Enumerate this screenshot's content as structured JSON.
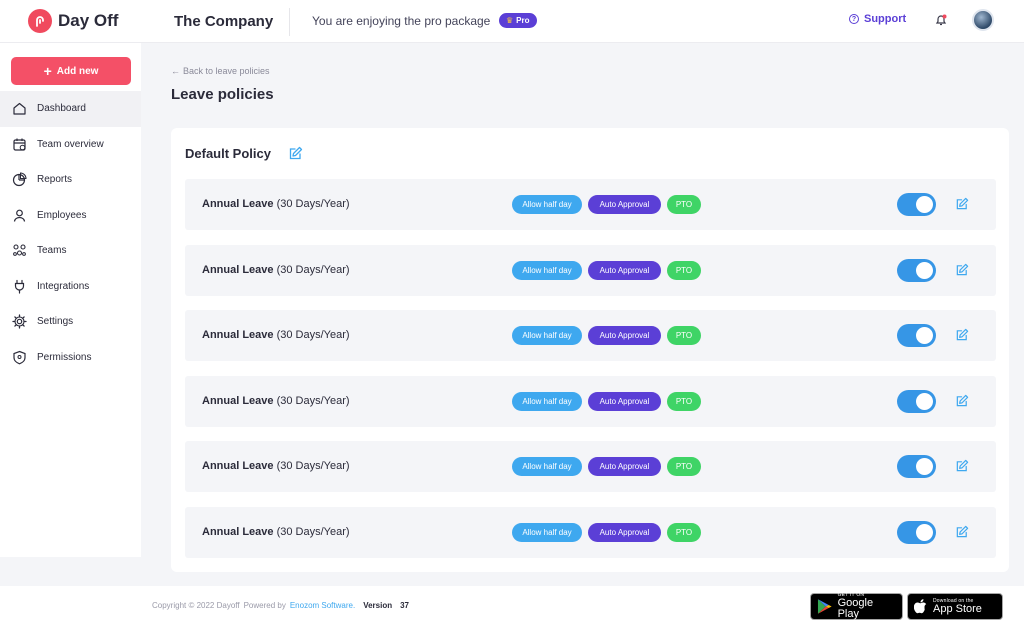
{
  "app": {
    "name": "Day Off",
    "company": "The Company",
    "promo_text": "You are enjoying the pro package",
    "pro_badge": "Pro",
    "support_label": "Support"
  },
  "colors": {
    "brand": "#f04a5e",
    "accent_purple": "#5b3fd6",
    "tag_blue": "#3ea8ef",
    "tag_green": "#3fd466",
    "toggle_on": "#3696e6"
  },
  "sidebar": {
    "add_button": "Add new",
    "items": [
      {
        "label": "Dashboard",
        "icon": "home-icon",
        "active": true
      },
      {
        "label": "Team overview",
        "icon": "calendar-icon",
        "active": false
      },
      {
        "label": "Reports",
        "icon": "pie-chart-icon",
        "active": false
      },
      {
        "label": "Employees",
        "icon": "user-icon",
        "active": false
      },
      {
        "label": "Teams",
        "icon": "teams-icon",
        "active": false
      },
      {
        "label": "Integrations",
        "icon": "plug-icon",
        "active": false
      },
      {
        "label": "Settings",
        "icon": "gear-icon",
        "active": false
      },
      {
        "label": "Permissions",
        "icon": "shield-icon",
        "active": false
      }
    ]
  },
  "main": {
    "back_link": "Back to leave policies",
    "title": "Leave policies",
    "policy_title": "Default Policy",
    "rows": [
      {
        "name": "Annual Leave",
        "detail": " (30 Days/Year)",
        "tags": [
          "Allow half day",
          "Auto Approval",
          "PTO"
        ],
        "enabled": true
      },
      {
        "name": "Annual Leave",
        "detail": " (30 Days/Year)",
        "tags": [
          "Allow half day",
          "Auto Approval",
          "PTO"
        ],
        "enabled": true
      },
      {
        "name": "Annual Leave",
        "detail": " (30 Days/Year)",
        "tags": [
          "Allow half day",
          "Auto Approval",
          "PTO"
        ],
        "enabled": true
      },
      {
        "name": "Annual Leave",
        "detail": " (30 Days/Year)",
        "tags": [
          "Allow half day",
          "Auto Approval",
          "PTO"
        ],
        "enabled": true
      },
      {
        "name": "Annual Leave",
        "detail": " (30 Days/Year)",
        "tags": [
          "Allow half day",
          "Auto Approval",
          "PTO"
        ],
        "enabled": true
      },
      {
        "name": "Annual Leave",
        "detail": " (30 Days/Year)",
        "tags": [
          "Allow half day",
          "Auto Approval",
          "PTO"
        ],
        "enabled": true
      }
    ]
  },
  "footer": {
    "copyright": "Copyright © 2022 Dayoff",
    "powered_by": "Powered by",
    "company_link": "Enozom Software.",
    "version_label": "Version",
    "version": "37",
    "google_play_small": "GET IT ON",
    "google_play_big": "Google Play",
    "app_store_small": "Download on the",
    "app_store_big": "App Store"
  }
}
